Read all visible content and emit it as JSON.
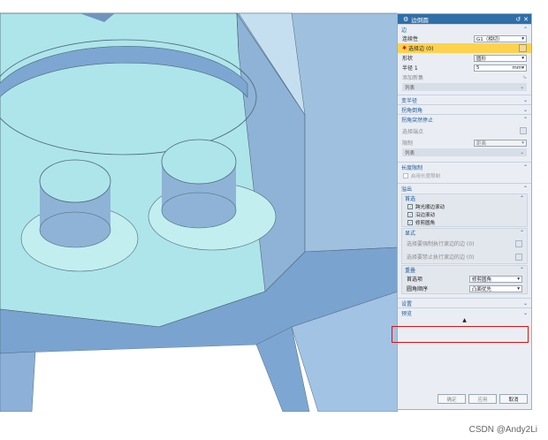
{
  "dialog": {
    "title": "边倒圆",
    "sections": {
      "edge": "边",
      "variable_radius": "变半径",
      "corner_setback": "拐角倒角",
      "corner_stop": "拐角突然停止",
      "length_limit": "长度限制",
      "overflow": "溢出",
      "settings": "设置",
      "preview": "预览"
    },
    "edge": {
      "continuity_label": "连续性",
      "continuity_value": "G1（相切）",
      "select_edge": "选择边 (0)",
      "shape_label": "形状",
      "shape_value": "圆形",
      "radius_label": "半径 1",
      "radius_value": "5",
      "radius_unit": "mm",
      "add_set": "添加新集",
      "list": "列表"
    },
    "corner_stop": {
      "select_endpoint": "选择端点",
      "limit_label": "限制",
      "limit_value": "距离",
      "list": "列表"
    },
    "length_limit": {
      "enable": "启用长度限制"
    },
    "overflow": {
      "preference": "首选",
      "pref_items": [
        "跨光顺边滚动",
        "沿边滚动",
        "修剪圆角"
      ],
      "explicit": "显式",
      "explicit_items": [
        "选择要强制执行滚边的边 (0)",
        "选择要禁止执行滚边的边 (0)"
      ],
      "resolve": "重叠",
      "resolve_label": "首选项",
      "resolve_value": "修剪圆角",
      "order_label": "圆角顺序",
      "order_value": "凸面优先"
    },
    "buttons": {
      "ok": "确定",
      "apply": "应用",
      "cancel": "取消"
    }
  },
  "watermark": "CSDN @Andy2Li",
  "colors": {
    "title_bar": "#2f6ea8",
    "model": "#aee5ea",
    "highlight": "#ffd24d",
    "callout": "#dd1111"
  }
}
